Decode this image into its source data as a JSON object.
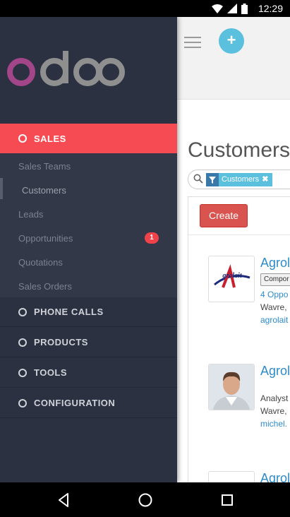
{
  "status_bar": {
    "time": "12:29"
  },
  "brand": {
    "logo_text": "odoo",
    "accent_color": "#f74b53",
    "logo_purple": "#a24689"
  },
  "sidebar": {
    "menus": [
      {
        "label": "SALES",
        "active": true
      },
      {
        "label": "PHONE CALLS"
      },
      {
        "label": "PRODUCTS"
      },
      {
        "label": "TOOLS"
      },
      {
        "label": "CONFIGURATION"
      }
    ],
    "sales_items": [
      {
        "label": "Sales Teams"
      },
      {
        "label": "Customers",
        "current": true
      },
      {
        "label": "Leads"
      },
      {
        "label": "Opportunities",
        "badge": "1"
      },
      {
        "label": "Quotations"
      },
      {
        "label": "Sales Orders"
      }
    ]
  },
  "main": {
    "page_title": "Customers",
    "search": {
      "facet_label": "Customers"
    },
    "create_label": "Create",
    "cards": [
      {
        "name": "Agrol",
        "tag": "Compor",
        "line1": "4 Oppo",
        "line2": "Wavre,",
        "line3": "agrolait"
      },
      {
        "name": "Agrol",
        "line1": "Analyst",
        "line2": "Wavre,",
        "line3": "michel."
      },
      {
        "name": "Agrol"
      }
    ]
  }
}
